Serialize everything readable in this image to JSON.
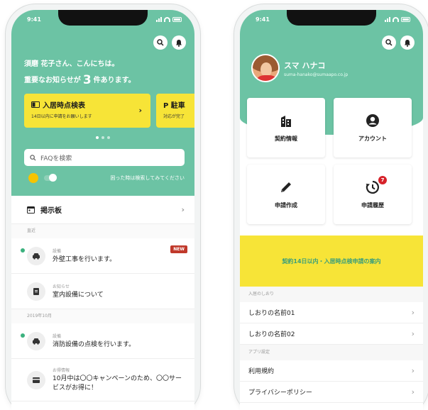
{
  "status_time": "9:41",
  "left": {
    "greeting_line1": "須磨 花子さん、こんにちは。",
    "greeting_pre": "重要なお知らせが",
    "greeting_count": "3",
    "greeting_post": "件あります。",
    "cards": [
      {
        "title": "入居時点検表",
        "subtitle": "14日以内に申請をお願いします",
        "icon": "card-icon"
      },
      {
        "title": "P 駐車",
        "subtitle": "対応が完了"
      }
    ],
    "search_placeholder": "FAQを検索",
    "chat_hint": "困った時は検索してみてください",
    "board_label": "掲示板",
    "section_today": "直近",
    "section_month": "2019年10月",
    "notices": [
      {
        "category": "設備",
        "title": "外壁工事を行います。",
        "badge": "NEW"
      },
      {
        "category": "お知らせ",
        "title": "室内設備について"
      },
      {
        "category": "設備",
        "title": "消防設備の点検を行います。"
      },
      {
        "category": "お得情報",
        "title": "10月中は〇〇キャンペーンのため、〇〇サービスがお得に！"
      }
    ]
  },
  "right": {
    "user_name": "スマ ハナコ",
    "user_email": "suma-hanako@sumaapo.co.jp",
    "tiles": [
      {
        "label": "契約情報",
        "icon": "building-icon"
      },
      {
        "label": "アカウント",
        "icon": "account-icon"
      },
      {
        "label": "申請作成",
        "icon": "pencil-icon"
      },
      {
        "label": "申請履歴",
        "icon": "history-icon",
        "badge": "7"
      }
    ],
    "banner": "契約14日以内・入居時点検申請の案内",
    "section_guide": "入居のしおり",
    "guides": [
      "しおりの名前01",
      "しおりの名前02"
    ],
    "section_app": "アプリ設定",
    "settings": [
      "利用規約",
      "プライバシーポリシー"
    ]
  },
  "colors": {
    "brand_green": "#6cc3a4",
    "accent_yellow": "#f7e437",
    "badge_red": "#d6222a"
  }
}
